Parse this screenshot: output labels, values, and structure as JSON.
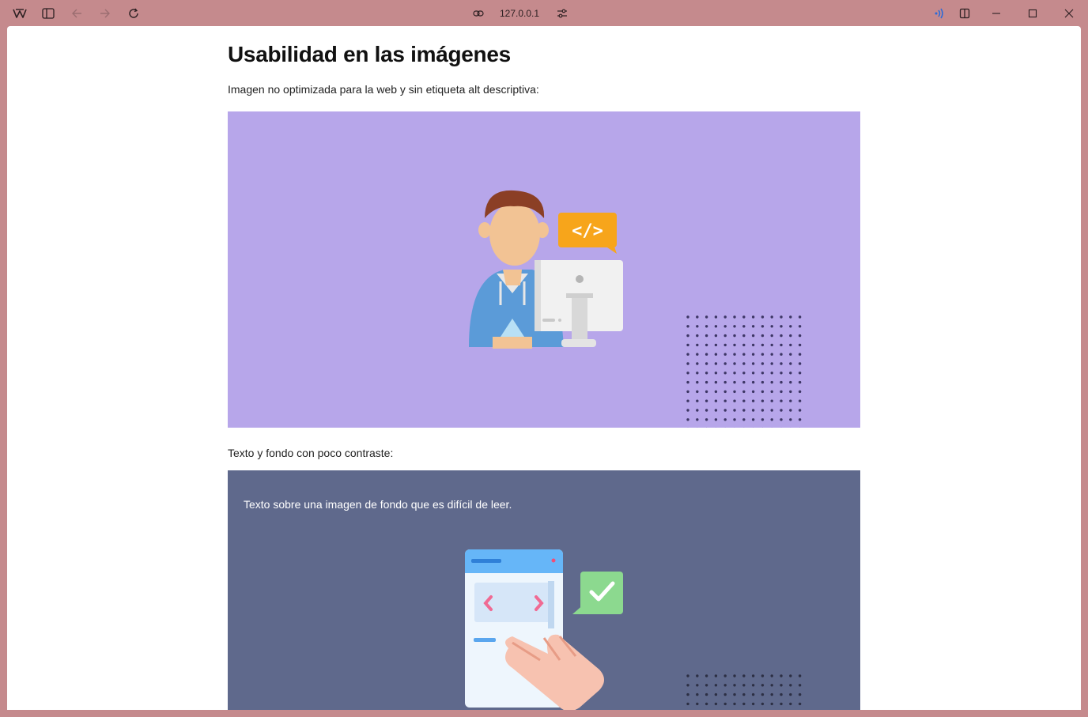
{
  "browser": {
    "url": "127.0.0.1",
    "icons": {
      "app": "browser-logo-icon",
      "sidebar": "sidebar-toggle-icon",
      "back": "arrow-left-icon",
      "forward": "arrow-right-icon",
      "reload": "reload-icon",
      "link": "link-icon",
      "settings": "tune-icon",
      "broadcast": "broadcast-icon",
      "split": "split-view-icon",
      "minimize": "minimize-icon",
      "maximize": "maximize-icon",
      "close": "close-icon"
    },
    "accent": "#c58a8d"
  },
  "page": {
    "title": "Usabilidad en las imágenes",
    "image1_caption": "Imagen no optimizada para la web y sin etiqueta alt descriptiva:",
    "image2_caption": "Texto y fondo con poco contraste:",
    "image2_overlay_text": "Texto sobre una imagen de fondo que es difícil de leer.",
    "image1_bg": "#b7a6ea",
    "image2_bg": "#5f698c"
  }
}
